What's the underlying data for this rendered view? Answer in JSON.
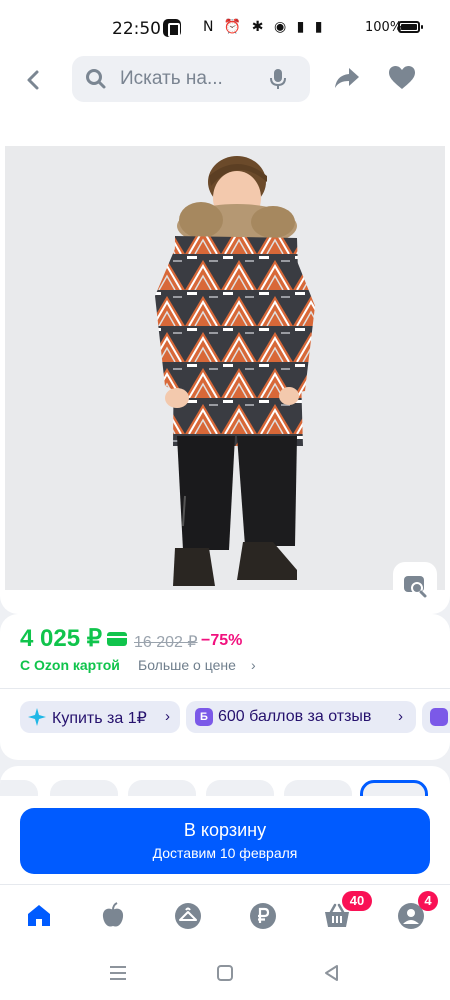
{
  "status_bar": {
    "time": "22:50",
    "icons": "N ⏰ ✱ ◉ ▮ ▮",
    "battery_percent": "100%"
  },
  "header": {
    "search_placeholder": "Искать на...",
    "icons": [
      "back-arrow-icon",
      "search-icon",
      "microphone-icon",
      "share-icon",
      "heart-icon"
    ]
  },
  "product": {
    "image_alt": "child-winter-jumpsuit-photo",
    "price": "4 025 ₽",
    "old_price": "16 202 ₽",
    "discount": "−75%",
    "ozon_card_label": "С Ozon картой",
    "price_more_label": "Больше о цене"
  },
  "promo": {
    "buy_for_1_label": "Купить за 1₽",
    "review_points_label": "600 баллов за отзыв"
  },
  "cart": {
    "button_label": "В корзину",
    "delivery_label": "Доставим 10 февраля"
  },
  "tabbar": {
    "items": [
      {
        "name": "home",
        "icon": "home-icon",
        "active": true
      },
      {
        "name": "fresh",
        "icon": "apple-icon",
        "active": false
      },
      {
        "name": "clothes",
        "icon": "hanger-icon",
        "active": false
      },
      {
        "name": "finance",
        "icon": "ruble-icon",
        "active": false
      },
      {
        "name": "cart",
        "icon": "basket-icon",
        "badge": "40",
        "active": false
      },
      {
        "name": "profile",
        "icon": "user-icon",
        "badge": "4",
        "active": false
      }
    ]
  },
  "colors": {
    "primary": "#005bff",
    "green_price": "#10c44c",
    "discount_pink": "#f1117e",
    "badge": "#f91155",
    "chip_bg": "#e8ebf6"
  }
}
